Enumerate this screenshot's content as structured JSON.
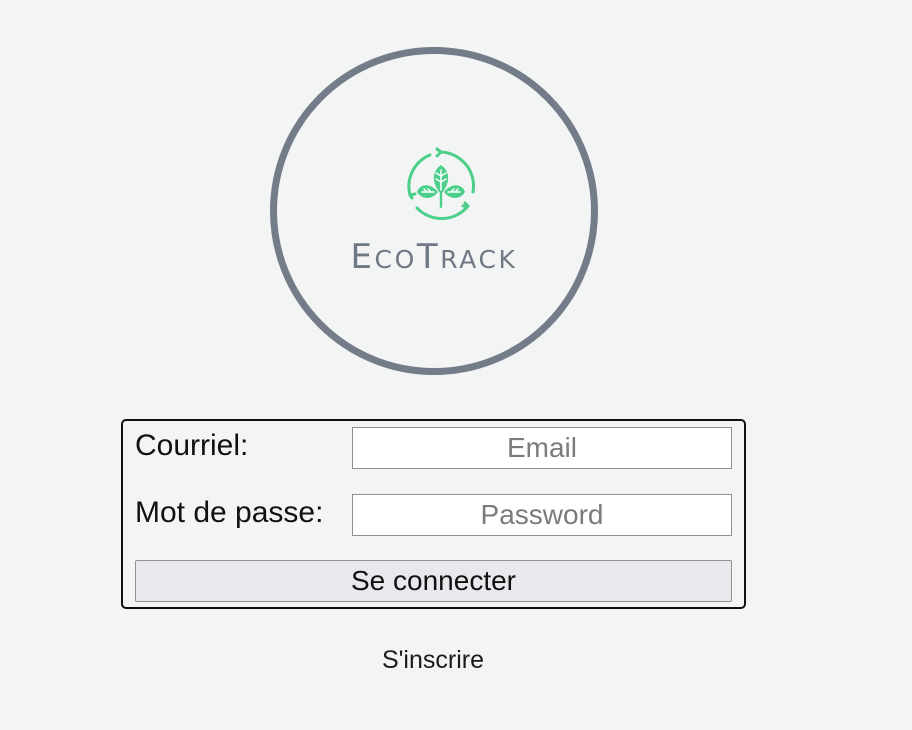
{
  "brand": {
    "wordmark_parts": [
      {
        "text": "E",
        "style": "cap"
      },
      {
        "text": "co",
        "style": "small"
      },
      {
        "text": "T",
        "style": "cap"
      },
      {
        "text": "rack",
        "style": "small"
      }
    ],
    "primary_color": "#4ccf8b",
    "secondary_color": "#747c89",
    "icon": "leaf-recycle-icon"
  },
  "login_form": {
    "email_label": "Courriel:",
    "email_placeholder": "Email",
    "email_value": "",
    "password_label": "Mot de passe:",
    "password_placeholder": "Password",
    "password_value": "",
    "submit_label": "Se connecter",
    "border_color": "#111111"
  },
  "signup": {
    "label": "S'inscrire"
  }
}
